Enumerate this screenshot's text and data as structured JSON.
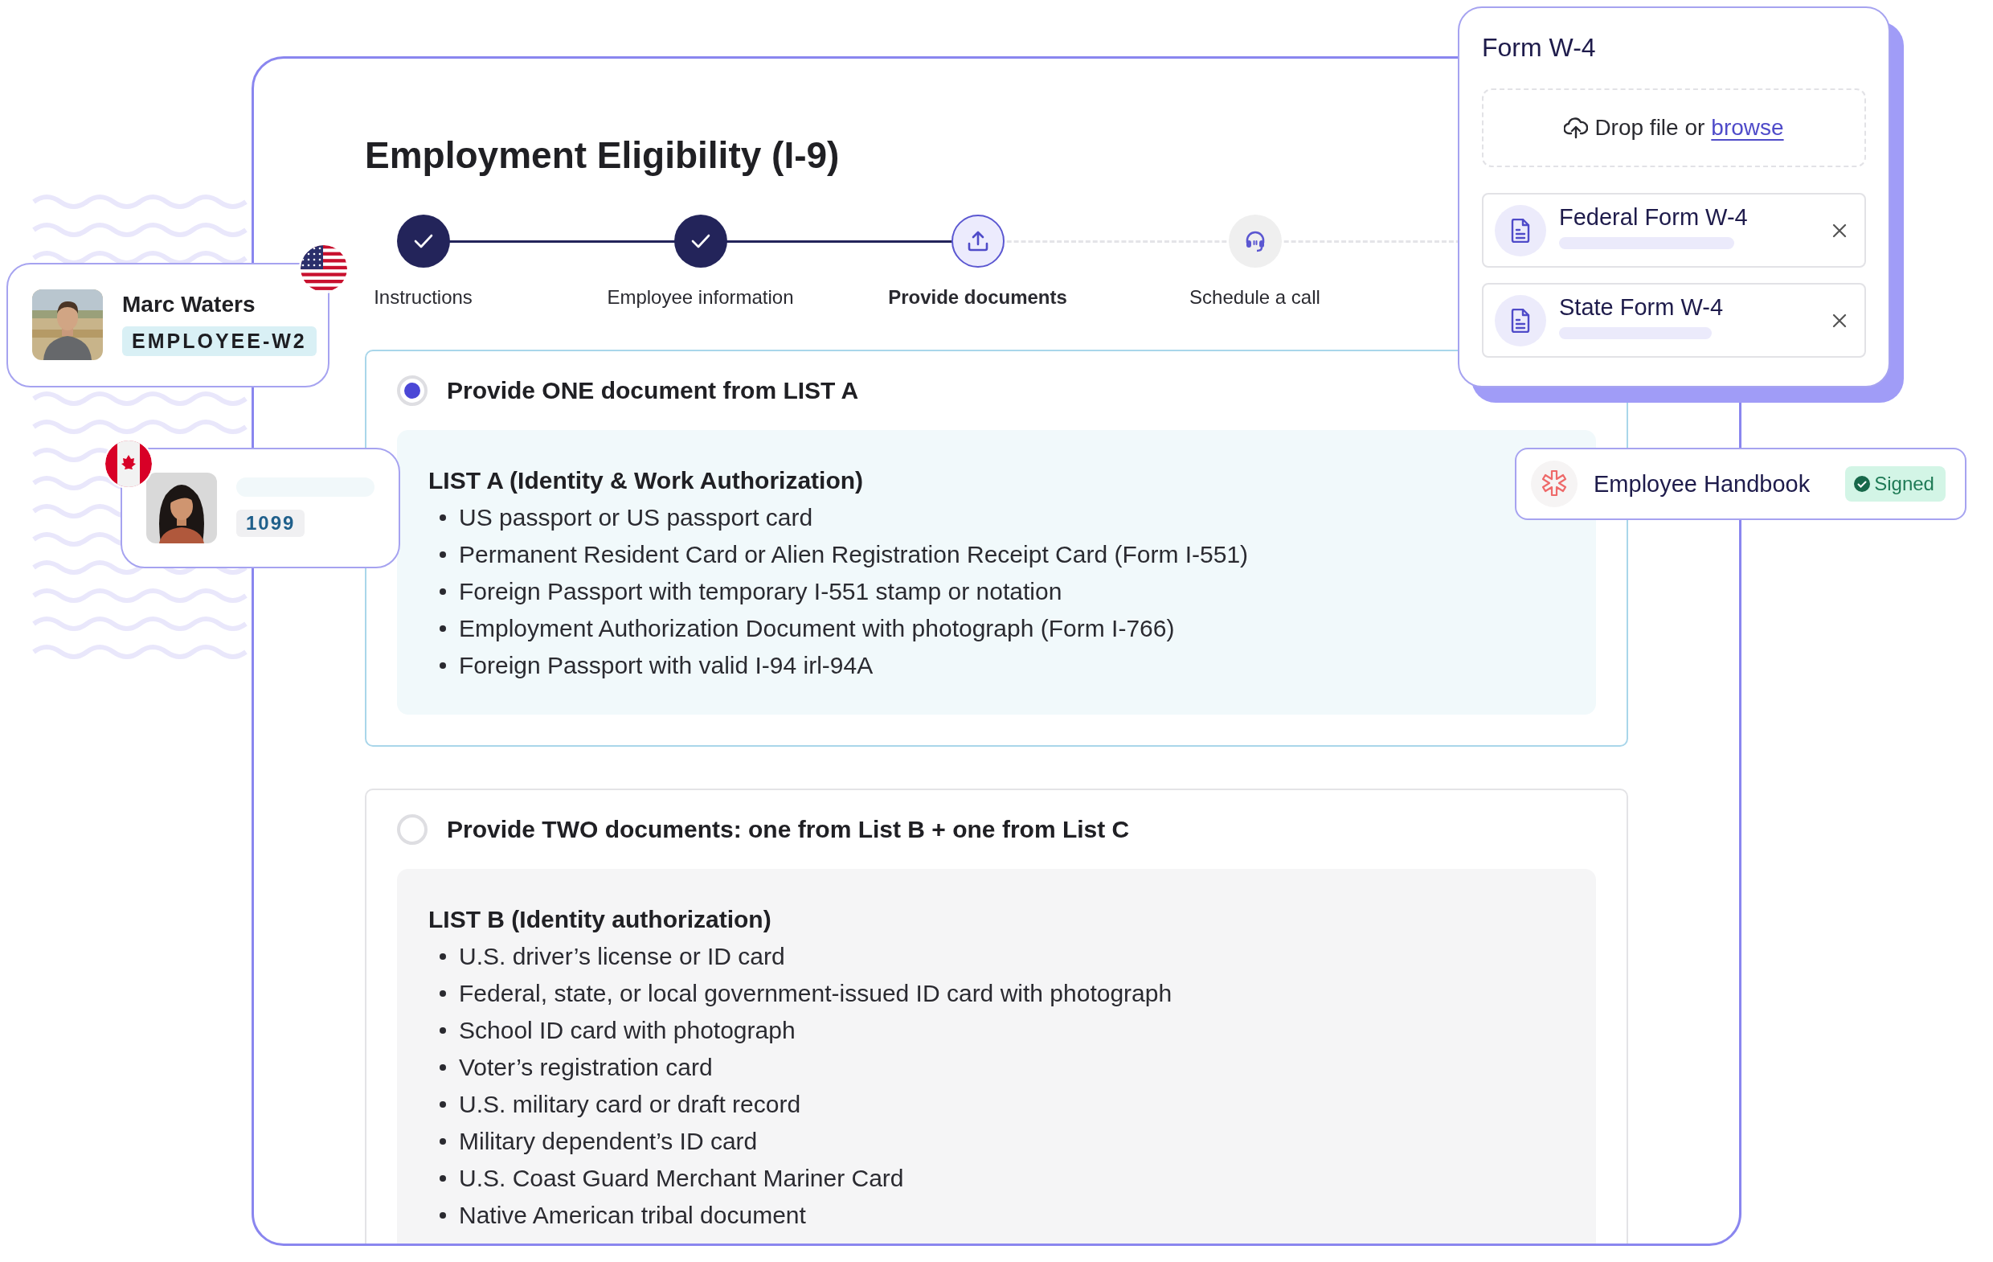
{
  "form": {
    "title": "Employment Eligibility (I-9)",
    "steps": [
      {
        "label": "Instructions",
        "completed": true,
        "selected": false,
        "kind": "check"
      },
      {
        "label": "Employee information",
        "completed": true,
        "selected": false,
        "kind": "check"
      },
      {
        "label": "Provide documents",
        "completed": false,
        "selected": true,
        "kind": "upload"
      },
      {
        "label": "Schedule a call",
        "completed": false,
        "selected": false,
        "kind": "headset"
      }
    ],
    "options": [
      {
        "heading": "Provide ONE document from LIST A",
        "selected": true,
        "list_title": "LIST A (Identity & Work Authorization)",
        "items": [
          "US passport or US passport card",
          "Permanent Resident Card or Alien Registration Receipt Card (Form I-551)",
          "Foreign Passport with temporary I-551 stamp or notation",
          "Employment Authorization Document with photograph (Form I-766)",
          "Foreign Passport with valid I-94 irl-94A"
        ]
      },
      {
        "heading": "Provide TWO documents: one from List B + one from List C",
        "selected": false,
        "list_title": "LIST B (Identity authorization)",
        "items": [
          "U.S. driver’s license or ID card",
          "Federal, state, or local government-issued ID card with photograph",
          "School ID card with photograph",
          "Voter’s registration card",
          "U.S. military card or draft record",
          "Military dependent’s ID card",
          "U.S. Coast Guard Merchant Mariner Card",
          "Native American tribal document"
        ]
      }
    ]
  },
  "employees": [
    {
      "name": "Marc Waters",
      "badge": "EMPLOYEE-W2",
      "kind": "us"
    },
    {
      "badge": "1099",
      "kind": "ca"
    }
  ],
  "w4": {
    "title": "Form W-4",
    "drop_text": "Drop file or",
    "drop_link": "browse",
    "files": [
      {
        "name": "Federal Form W-4"
      },
      {
        "name": "State Form W-4"
      }
    ]
  },
  "handbook": {
    "title": "Employee Handbook",
    "status": "Signed",
    "signed": true
  }
}
